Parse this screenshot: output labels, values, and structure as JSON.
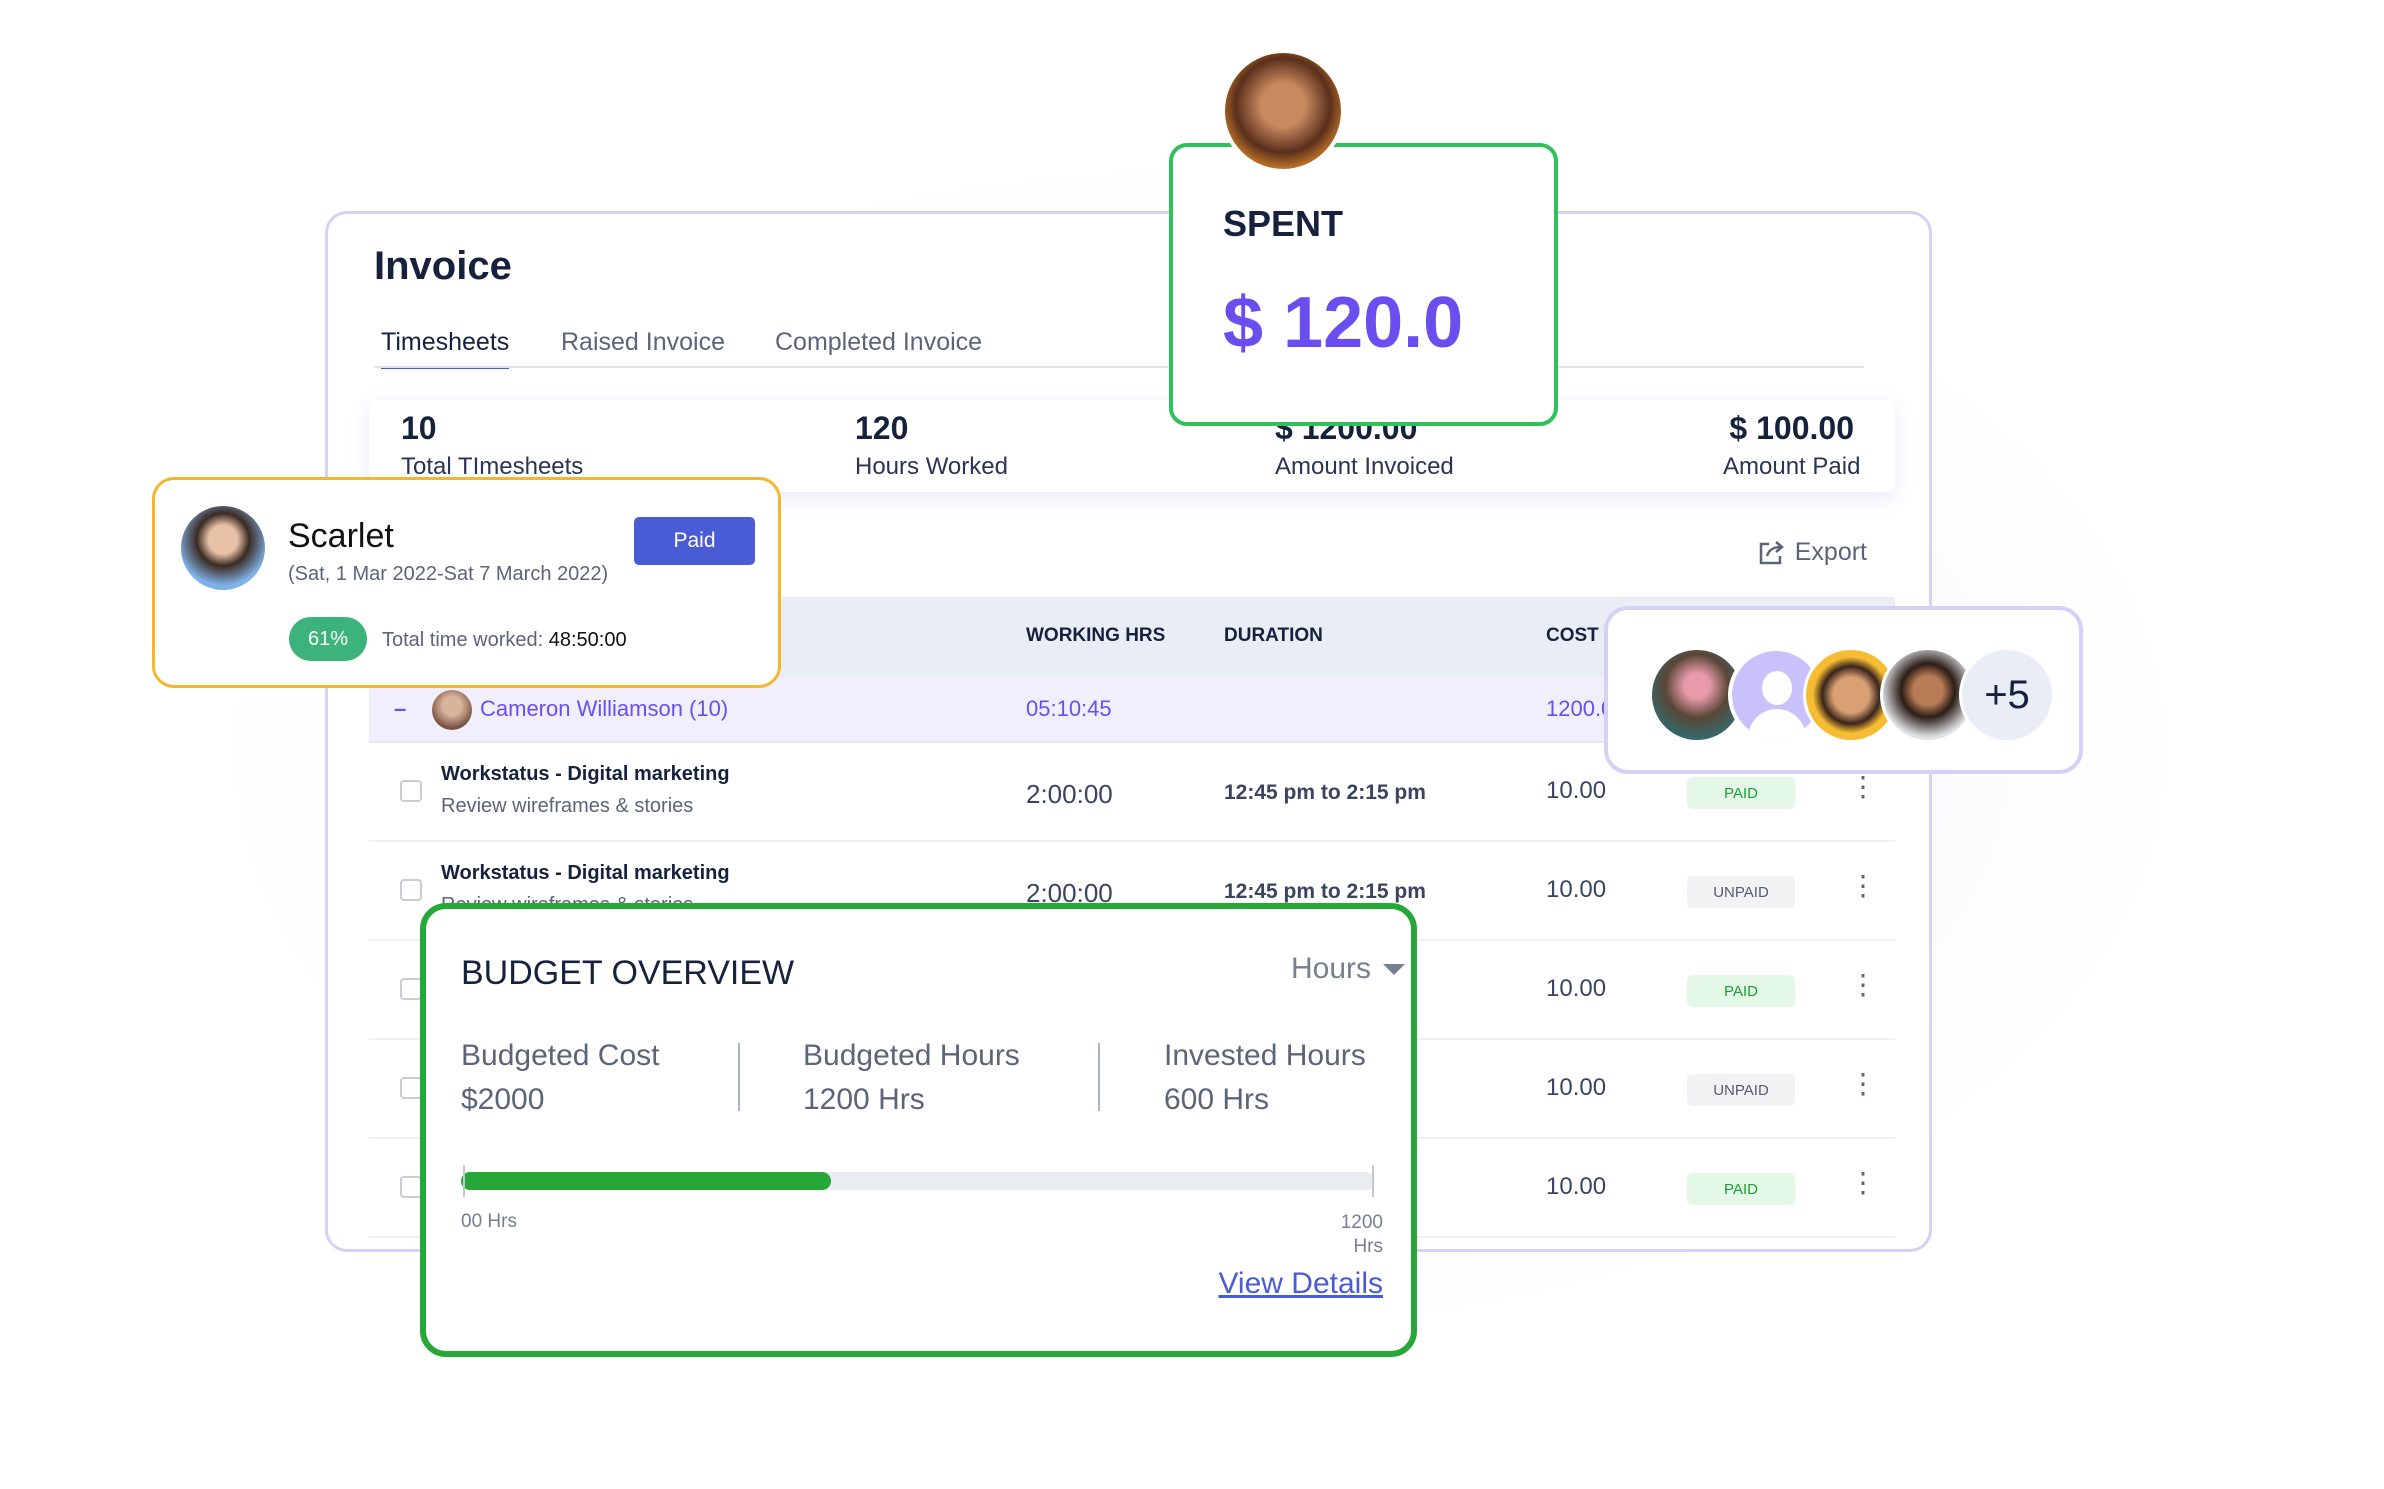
{
  "invoice": {
    "title": "Invoice",
    "tabs": [
      {
        "label": "Timesheets",
        "active": true
      },
      {
        "label": "Raised Invoice"
      },
      {
        "label": "Completed Invoice"
      }
    ],
    "stats": [
      {
        "value": "10",
        "label": "Total TImesheets"
      },
      {
        "value": "120",
        "label": "Hours Worked"
      },
      {
        "value": "$ 1200.00",
        "label": "Amount Invoiced"
      },
      {
        "value": "$ 100.00",
        "label": "Amount Paid"
      }
    ],
    "export_label": "Export",
    "columns": {
      "working_hrs": "WORKING HRS",
      "duration": "DURATION",
      "cost": "COST"
    },
    "group": {
      "toggle": "–",
      "name": "Cameron Williamson (10)",
      "working_hrs": "05:10:45",
      "cost": "1200.00"
    },
    "rows": [
      {
        "title": "Workstatus - Digital marketing",
        "subtitle": "Review wireframes & stories",
        "working_hrs": "2:00:00",
        "duration": "12:45 pm to 2:15 pm",
        "cost": "10.00",
        "status": "PAID"
      },
      {
        "title": "Workstatus - Digital marketing",
        "subtitle": "Review wireframes & stories",
        "working_hrs": "2:00:00",
        "duration": "12:45 pm to 2:15 pm",
        "cost": "10.00",
        "status": "UNPAID"
      },
      {
        "cost": "10.00",
        "status": "PAID"
      },
      {
        "cost": "10.00",
        "status": "UNPAID"
      },
      {
        "cost": "10.00",
        "status": "PAID"
      }
    ]
  },
  "spent": {
    "label": "SPENT",
    "amount": "$ 120.0"
  },
  "scarlet": {
    "name": "Scarlet",
    "dates": "(Sat, 1 Mar 2022-Sat 7 March 2022)",
    "status": "Paid",
    "percent": "61%",
    "time_label": "Total time worked:",
    "time_value": "48:50:00"
  },
  "team": {
    "more": "+5"
  },
  "budget": {
    "title": "BUDGET OVERVIEW",
    "unit_select": "Hours",
    "metrics": [
      {
        "label": "Budgeted Cost",
        "value": "$2000"
      },
      {
        "label": "Budgeted Hours",
        "value": "1200 Hrs"
      },
      {
        "label": "Invested Hours",
        "value": "600 Hrs"
      }
    ],
    "progress": 0.405,
    "min_label": "00 Hrs",
    "max_label": "1200",
    "max_unit": "Hrs",
    "link": "View Details"
  },
  "colors": {
    "accent": "#4a5bd6",
    "purple": "#6b4ef0",
    "green": "#27a737",
    "orange": "#f5b52c"
  }
}
